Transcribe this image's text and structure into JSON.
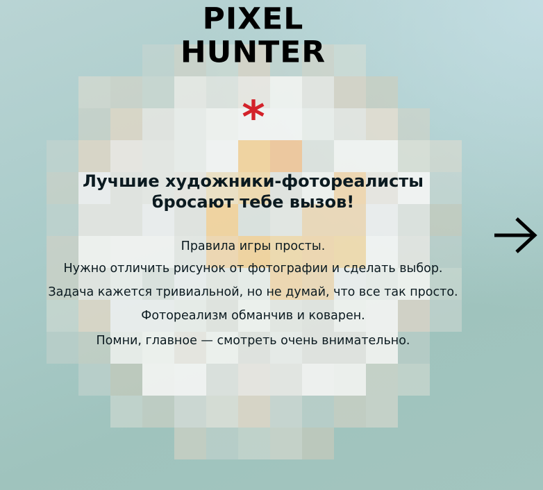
{
  "logo": {
    "line1": "PIXEL",
    "line2": "HUNTER"
  },
  "intro": {
    "mark": "*",
    "heading_line1": "Лучшие художники-фотореалисты",
    "heading_line2": "бросают тебе вызов!",
    "rules": [
      "Правила игры просты.",
      "Нужно отличить рисунок от фотографии и сделать выбор.",
      "Задача кажется тривиальной, но не думай, что все так просто.",
      "Фотореализм обманчив и коварен.",
      "Помни, главное — смотреть очень внимательно."
    ]
  },
  "next_button": {
    "icon": "arrow-right-icon"
  },
  "colors": {
    "asterisk": "#d3222a",
    "text": "#0b1a20"
  }
}
